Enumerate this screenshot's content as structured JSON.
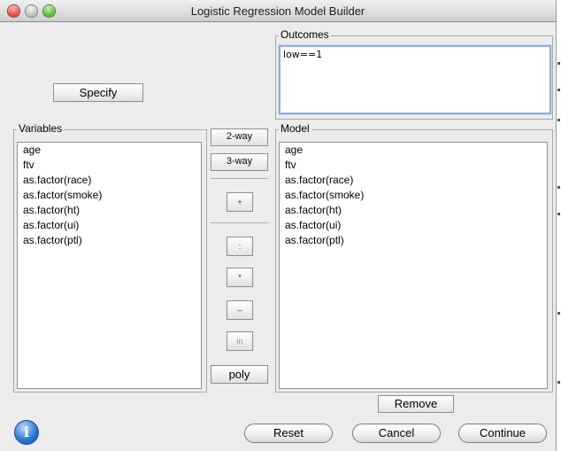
{
  "window": {
    "title": "Logistic Regression Model Builder"
  },
  "outcomes": {
    "label": "Outcomes",
    "value": "low==1"
  },
  "specify_label": "Specify",
  "variables": {
    "label": "Variables",
    "items": [
      "age",
      "ftv",
      "as.factor(race)",
      "as.factor(smoke)",
      "as.factor(ht)",
      "as.factor(ui)",
      "as.factor(ptl)"
    ]
  },
  "model": {
    "label": "Model",
    "items": [
      "age",
      "ftv",
      "as.factor(race)",
      "as.factor(smoke)",
      "as.factor(ht)",
      "as.factor(ui)",
      "as.factor(ptl)"
    ]
  },
  "middle": {
    "two_way": "2-way",
    "three_way": "3-way",
    "plus": "+",
    "colon": ":",
    "star": "*",
    "minus": "–",
    "in": "in",
    "poly": "poly"
  },
  "remove_label": "Remove",
  "footer": {
    "reset": "Reset",
    "cancel": "Cancel",
    "continue": "Continue",
    "info": "i"
  }
}
